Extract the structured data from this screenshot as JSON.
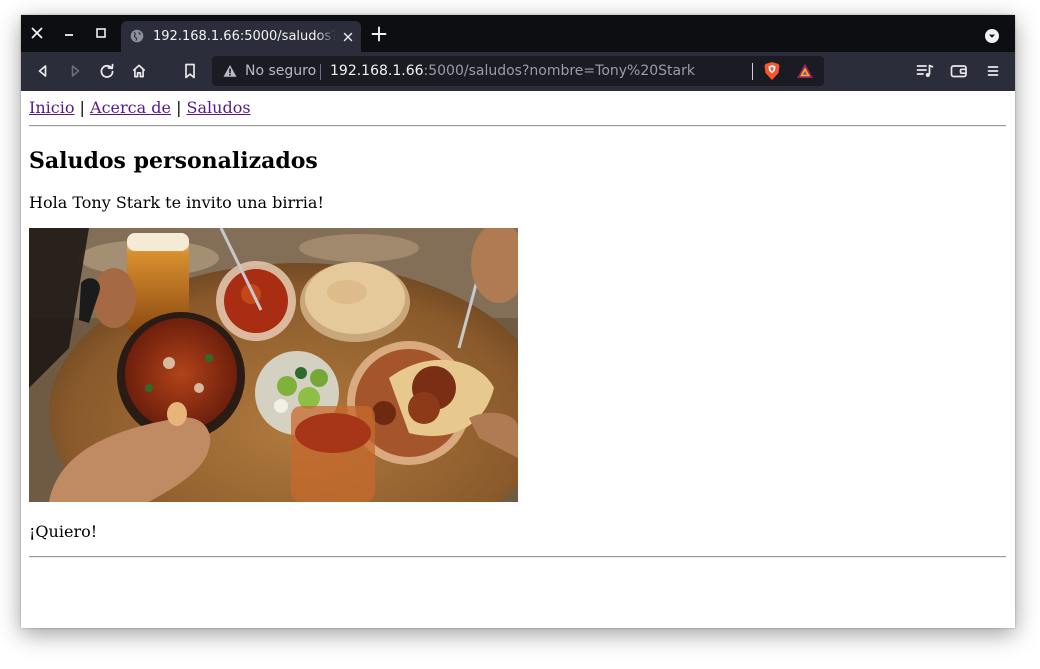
{
  "browser": {
    "tab": {
      "title": "192.168.1.66:5000/saludos?nombre=Tony%20Stark"
    },
    "address_bar": {
      "security_label": "No seguro",
      "url_host": "192.168.1.66",
      "url_rest": ":5000/saludos?nombre=Tony%20Stark"
    },
    "icons": {
      "window_controls": [
        "close-icon",
        "minimize-icon",
        "maximize-icon"
      ],
      "tab": [
        "globe-icon",
        "close-icon"
      ],
      "toolbar": [
        "back-icon",
        "forward-icon",
        "reload-icon",
        "home-icon",
        "bookmark-icon",
        "warning-icon",
        "brave-shields-icon",
        "brave-rewards-icon",
        "playlist-icon",
        "wallet-icon",
        "menu-icon",
        "new-tab-icon",
        "tab-menu-icon"
      ]
    },
    "colors": {
      "tab_strip": "#0d0e12",
      "toolbar": "#2b2d3a",
      "url_field": "#1a1b23",
      "brave_shield": "#fb542b"
    }
  },
  "page": {
    "nav": {
      "items": [
        "Inicio",
        "Acerca de",
        "Saludos"
      ],
      "separator": "|",
      "link_color": "#551a8b"
    },
    "heading": "Saludos personalizados",
    "greeting": "Hola Tony Stark te invito una birria!",
    "image": {
      "subject": "birria tacos, consomé, tortillas, limes and beer on a wooden table"
    },
    "footer_text": "¡Quiero!"
  }
}
